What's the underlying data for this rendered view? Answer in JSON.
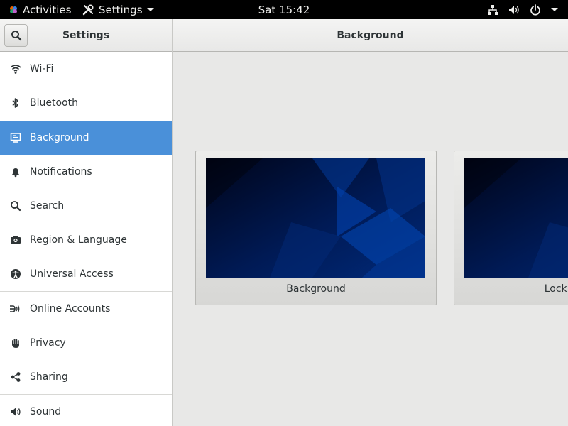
{
  "topbar": {
    "activities_label": "Activities",
    "app_menu_label": "Settings",
    "clock": "Sat 15:42"
  },
  "headerbar": {
    "left_title": "Settings",
    "main_title": "Background"
  },
  "sidebar": {
    "items": [
      {
        "label": "Wi-Fi",
        "icon": "wifi-icon"
      },
      {
        "label": "Bluetooth",
        "icon": "bluetooth-icon"
      },
      {
        "label": "Background",
        "icon": "background-icon",
        "active": true
      },
      {
        "label": "Notifications",
        "icon": "bell-icon"
      },
      {
        "label": "Search",
        "icon": "search-icon"
      },
      {
        "label": "Region & Language",
        "icon": "camera-icon"
      },
      {
        "label": "Universal Access",
        "icon": "accessibility-icon"
      },
      {
        "label": "Online Accounts",
        "icon": "online-accounts-icon"
      },
      {
        "label": "Privacy",
        "icon": "hand-icon"
      },
      {
        "label": "Sharing",
        "icon": "share-icon"
      },
      {
        "label": "Sound",
        "icon": "speaker-icon"
      }
    ],
    "active_color": "#4a90d9"
  },
  "main": {
    "cards": [
      {
        "label": "Background"
      },
      {
        "label": "Lock Screen"
      }
    ]
  }
}
